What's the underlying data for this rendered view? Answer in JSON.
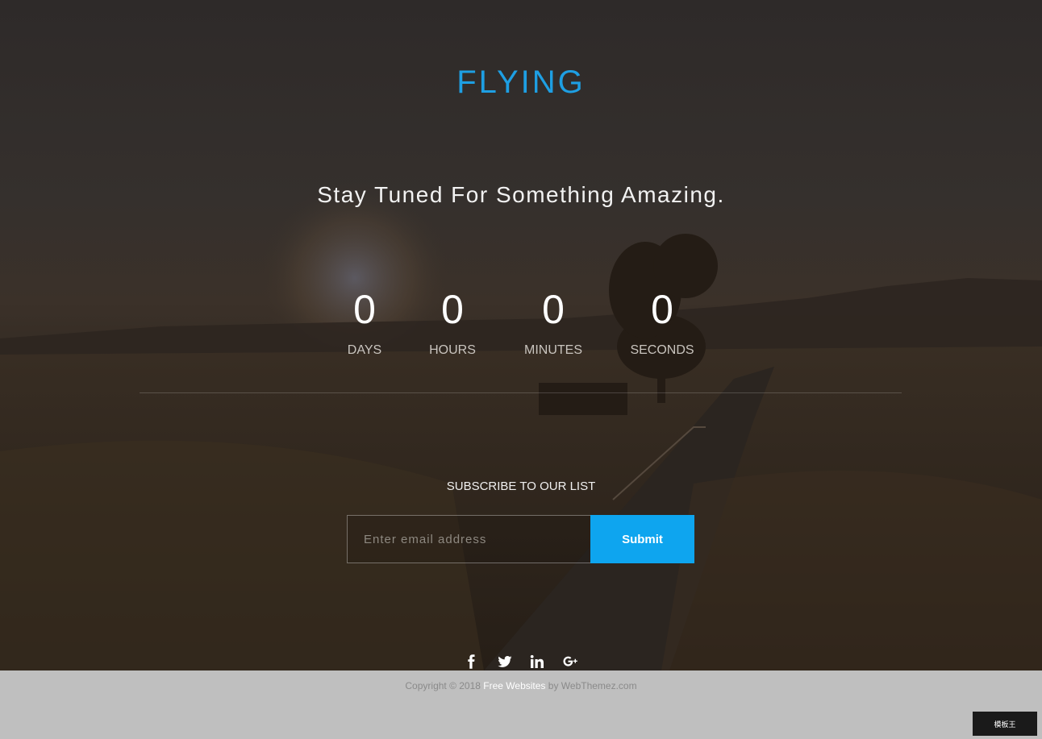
{
  "brand": {
    "title": "FLYING"
  },
  "hero": {
    "tagline": "Stay Tuned For Something Amazing."
  },
  "countdown": {
    "units": [
      {
        "value": "0",
        "label": "DAYS"
      },
      {
        "value": "0",
        "label": "HOURS"
      },
      {
        "value": "0",
        "label": "MINUTES"
      },
      {
        "value": "0",
        "label": "SECONDS"
      }
    ]
  },
  "subscribe": {
    "title": "SUBSCRIBE TO OUR LIST",
    "placeholder": "Enter email address",
    "submit_label": "Submit"
  },
  "social": {
    "icons": [
      "facebook-icon",
      "twitter-icon",
      "linkedin-icon",
      "google-plus-icon"
    ]
  },
  "footer": {
    "copyright_prefix": "Copyright © 2018",
    "link_text": "Free Websites",
    "copyright_suffix": "by WebThemez.com",
    "watermark_text": "模板王"
  },
  "colors": {
    "brand": "#1e9fe3",
    "submit": "#0ea5ef",
    "footer_bg": "#bfbfbf"
  }
}
